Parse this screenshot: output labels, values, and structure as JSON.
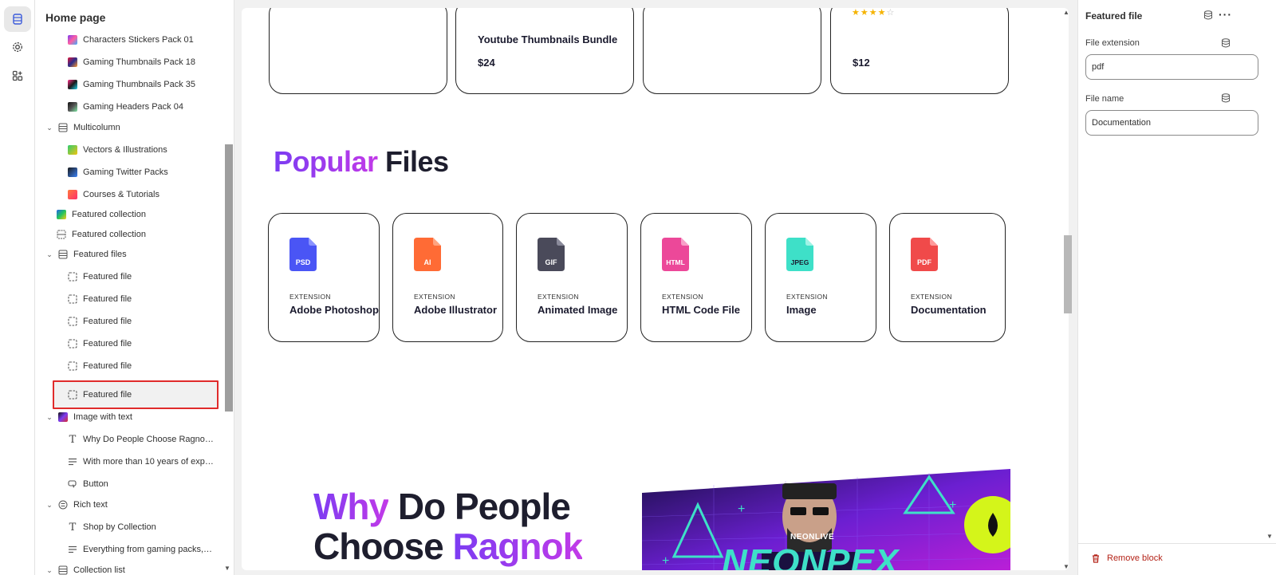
{
  "rail": {
    "items": [
      {
        "name": "sections",
        "active": true
      },
      {
        "name": "settings",
        "active": false
      },
      {
        "name": "apps",
        "active": false
      }
    ]
  },
  "tree": {
    "title": "Home page",
    "items": [
      {
        "label": "Characters Stickers Pack 01"
      },
      {
        "label": "Gaming Thumbnails Pack 18"
      },
      {
        "label": "Gaming Thumbnails Pack 35"
      },
      {
        "label": "Gaming Headers Pack 04"
      },
      {
        "label": "Multicolumn"
      },
      {
        "label": "Vectors & Illustrations"
      },
      {
        "label": "Gaming Twitter Packs"
      },
      {
        "label": "Courses & Tutorials"
      },
      {
        "label": "Featured collection"
      },
      {
        "label": "Featured collection"
      },
      {
        "label": "Featured files"
      },
      {
        "label": "Featured file"
      },
      {
        "label": "Featured file"
      },
      {
        "label": "Featured file"
      },
      {
        "label": "Featured file"
      },
      {
        "label": "Featured file"
      },
      {
        "label": "Featured file"
      },
      {
        "label": "Image with text"
      },
      {
        "label": "Why Do People Choose Ragnok ..."
      },
      {
        "label": "With more than 10 years of expe..."
      },
      {
        "label": "Button"
      },
      {
        "label": "Rich text"
      },
      {
        "label": "Shop by Collection"
      },
      {
        "label": "Everything from gaming packs, i..."
      },
      {
        "label": "Collection list"
      }
    ]
  },
  "preview": {
    "products": [
      {
        "title": "",
        "price": ""
      },
      {
        "title": "Youtube Thumbnails Bundle",
        "price": "$24"
      },
      {
        "title": "",
        "price": ""
      },
      {
        "title": "",
        "price": "$12",
        "rating": 4,
        "max_rating": 5
      }
    ],
    "popular_title_accent": "Popular",
    "popular_title_rest": " Files",
    "files": [
      {
        "ext": "PSD",
        "ext_label": "EXTENSION",
        "name": "Adobe Photoshop",
        "color": "#4a55f5"
      },
      {
        "ext": "AI",
        "ext_label": "EXTENSION",
        "name": "Adobe Illustrator",
        "color": "#ff6b35"
      },
      {
        "ext": "GIF",
        "ext_label": "EXTENSION",
        "name": "Animated Image",
        "color": "#4a4a5a"
      },
      {
        "ext": "HTML",
        "ext_label": "EXTENSION",
        "name": "HTML Code File",
        "color": "#ec4899"
      },
      {
        "ext": "JPEG",
        "ext_label": "EXTENSION",
        "name": "Image",
        "color": "#3ee0c8"
      },
      {
        "ext": "PDF",
        "ext_label": "EXTENSION",
        "name": "Documentation",
        "color": "#f04a4a"
      }
    ],
    "why_line1_accent": "Why",
    "why_line1_rest": " Do People",
    "why_line2_rest": "Choose ",
    "why_line2_accent": "Ragnok",
    "banner_brand": "NEONLIVE",
    "banner_text": "NEONPEX"
  },
  "settings": {
    "title": "Featured file",
    "file_extension_label": "File extension",
    "file_extension_value": "pdf",
    "file_name_label": "File name",
    "file_name_value": "Documentation",
    "remove_label": "Remove block"
  },
  "colors": {
    "accent_purple": "#7b3cf2",
    "selection_red": "#e02b2b",
    "remove_red": "#b42318"
  }
}
